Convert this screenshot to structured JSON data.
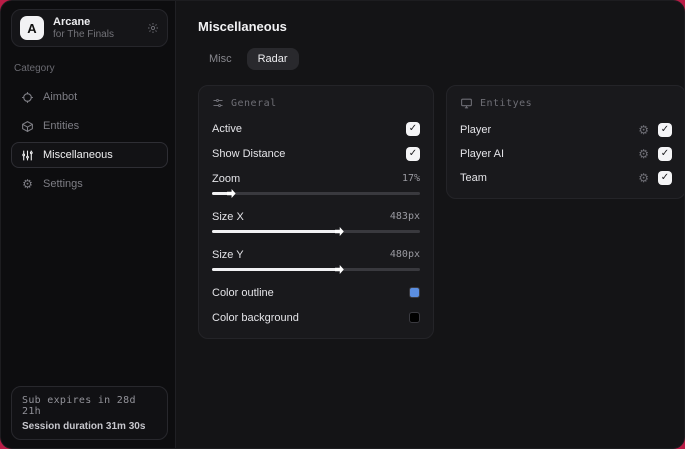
{
  "header": {
    "app_name": "Arcane",
    "app_subtitle": "for The Finals",
    "logo_letter": "A"
  },
  "sidebar": {
    "category_label": "Category",
    "items": [
      {
        "label": "Aimbot",
        "icon": "crosshair-icon",
        "active": false
      },
      {
        "label": "Entities",
        "icon": "cube-icon",
        "active": false
      },
      {
        "label": "Miscellaneous",
        "icon": "sliders-icon",
        "active": true
      },
      {
        "label": "Settings",
        "icon": "gear-icon",
        "active": false
      }
    ],
    "footer": {
      "sub_expires": "Sub expires in 28d 21h",
      "session_duration": "Session duration 31m 30s"
    }
  },
  "main": {
    "title": "Miscellaneous",
    "tabs": [
      {
        "label": "Misc",
        "active": false
      },
      {
        "label": "Radar",
        "active": true
      }
    ]
  },
  "general": {
    "title": "General",
    "rows": {
      "active": {
        "label": "Active",
        "checked": true,
        "check_glyph": "✓"
      },
      "show_distance": {
        "label": "Show Distance",
        "checked": true,
        "check_glyph": "✓"
      },
      "zoom": {
        "label": "Zoom",
        "value": "17%",
        "fill": 8
      },
      "size_x": {
        "label": "Size X",
        "value": "483px",
        "fill": 60
      },
      "size_y": {
        "label": "Size Y",
        "value": "480px",
        "fill": 60
      },
      "color_outline": {
        "label": "Color outline",
        "color": "#5b8ee0"
      },
      "color_background": {
        "label": "Color background",
        "color": "#000000"
      }
    }
  },
  "entities": {
    "title": "Entityes",
    "gear_glyph": "⚙",
    "rows": [
      {
        "label": "Player",
        "checked": true,
        "check_glyph": "✓"
      },
      {
        "label": "Player AI",
        "checked": true,
        "check_glyph": "✓"
      },
      {
        "label": "Team",
        "checked": true,
        "check_glyph": "✓"
      }
    ]
  },
  "colors": {
    "accent_background": "#b91c46",
    "outline_swatch": "#5b8ee0",
    "background_swatch": "#000000"
  }
}
